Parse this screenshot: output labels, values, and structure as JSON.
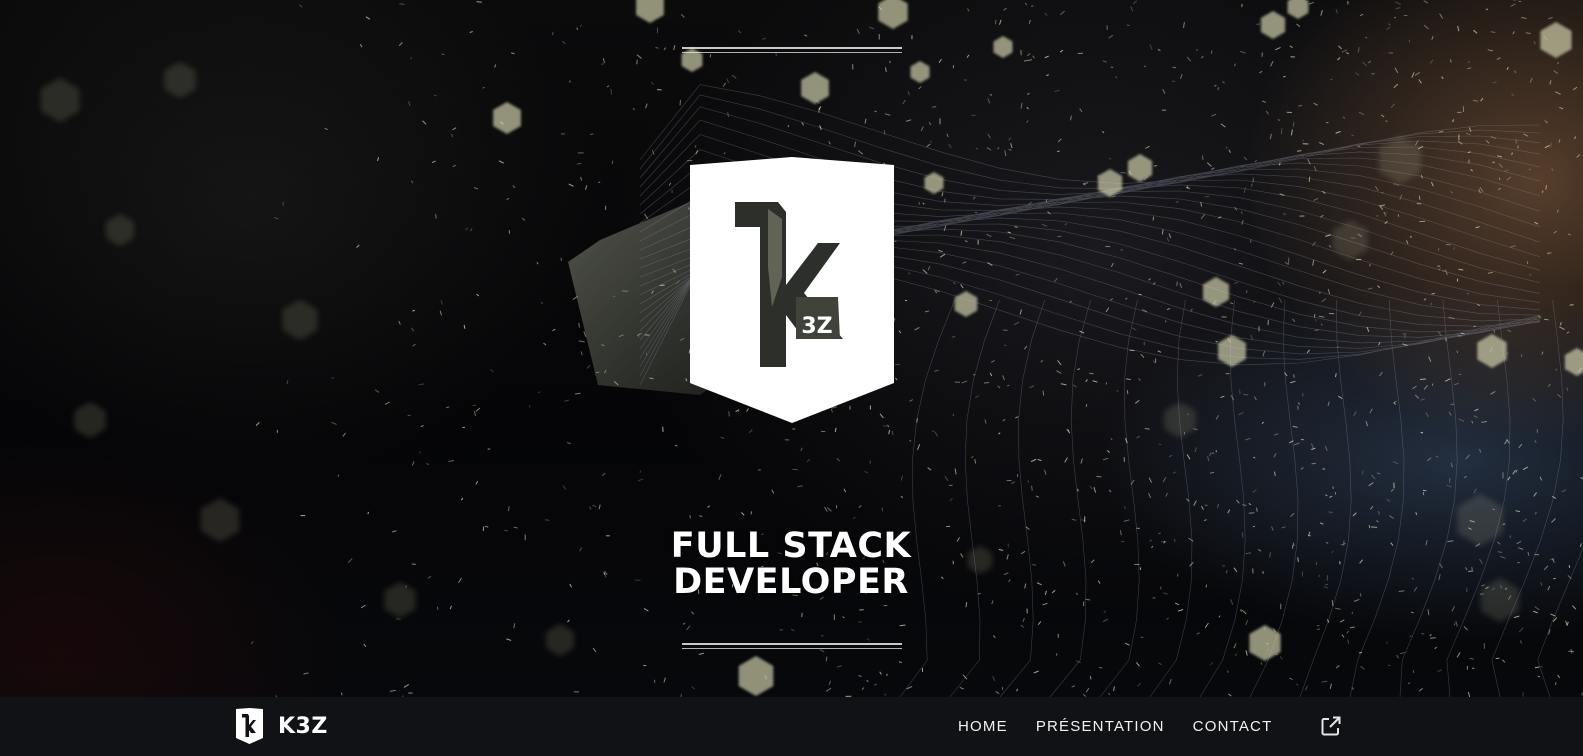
{
  "hero": {
    "title_line1": "FULL STACK",
    "title_line2": "DEVELOPER",
    "logo_icon": "k3z-shield-logo-icon",
    "logo_text": "3Z"
  },
  "navbar": {
    "brand_name": "K3Z",
    "brand_icon": "k3z-shield-logo-icon",
    "links": [
      {
        "label": "HOME"
      },
      {
        "label": "PRÉSENTATION"
      },
      {
        "label": "CONTACT"
      }
    ],
    "external_icon": "external-link-icon"
  },
  "colors": {
    "background": "#050608",
    "navbar": "#111215",
    "text": "#ffffff",
    "bokeh": "#dcdcb4"
  }
}
